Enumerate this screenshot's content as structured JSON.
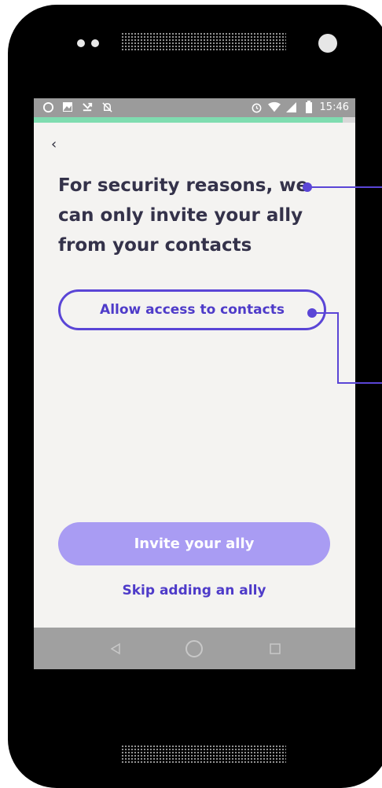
{
  "statusbar": {
    "left_icons": [
      "chat-bubble-icon",
      "image-icon",
      "missed-call-icon",
      "notifications-off-icon"
    ],
    "right_icons": [
      "alarm-icon",
      "wifi-icon",
      "signal-icon",
      "battery-icon"
    ],
    "time": "15:46"
  },
  "progress": {
    "fraction": 0.96,
    "color": "#7fdcb0"
  },
  "header": {
    "back_label": "‹"
  },
  "main": {
    "headline": "For security reasons, we can only invite your ally from your contacts",
    "allow_button": "Allow access to contacts",
    "invite_button": "Invite your ally",
    "skip_link": "Skip adding an ally"
  },
  "navbar": {
    "buttons": [
      "back-triangle-icon",
      "home-circle-icon",
      "recents-square-icon"
    ]
  },
  "colors": {
    "accent": "#4e3bc9",
    "invite_button_bg": "#a99cf3",
    "annotation": "#5a45d6",
    "screen_bg": "#f4f3f1"
  }
}
